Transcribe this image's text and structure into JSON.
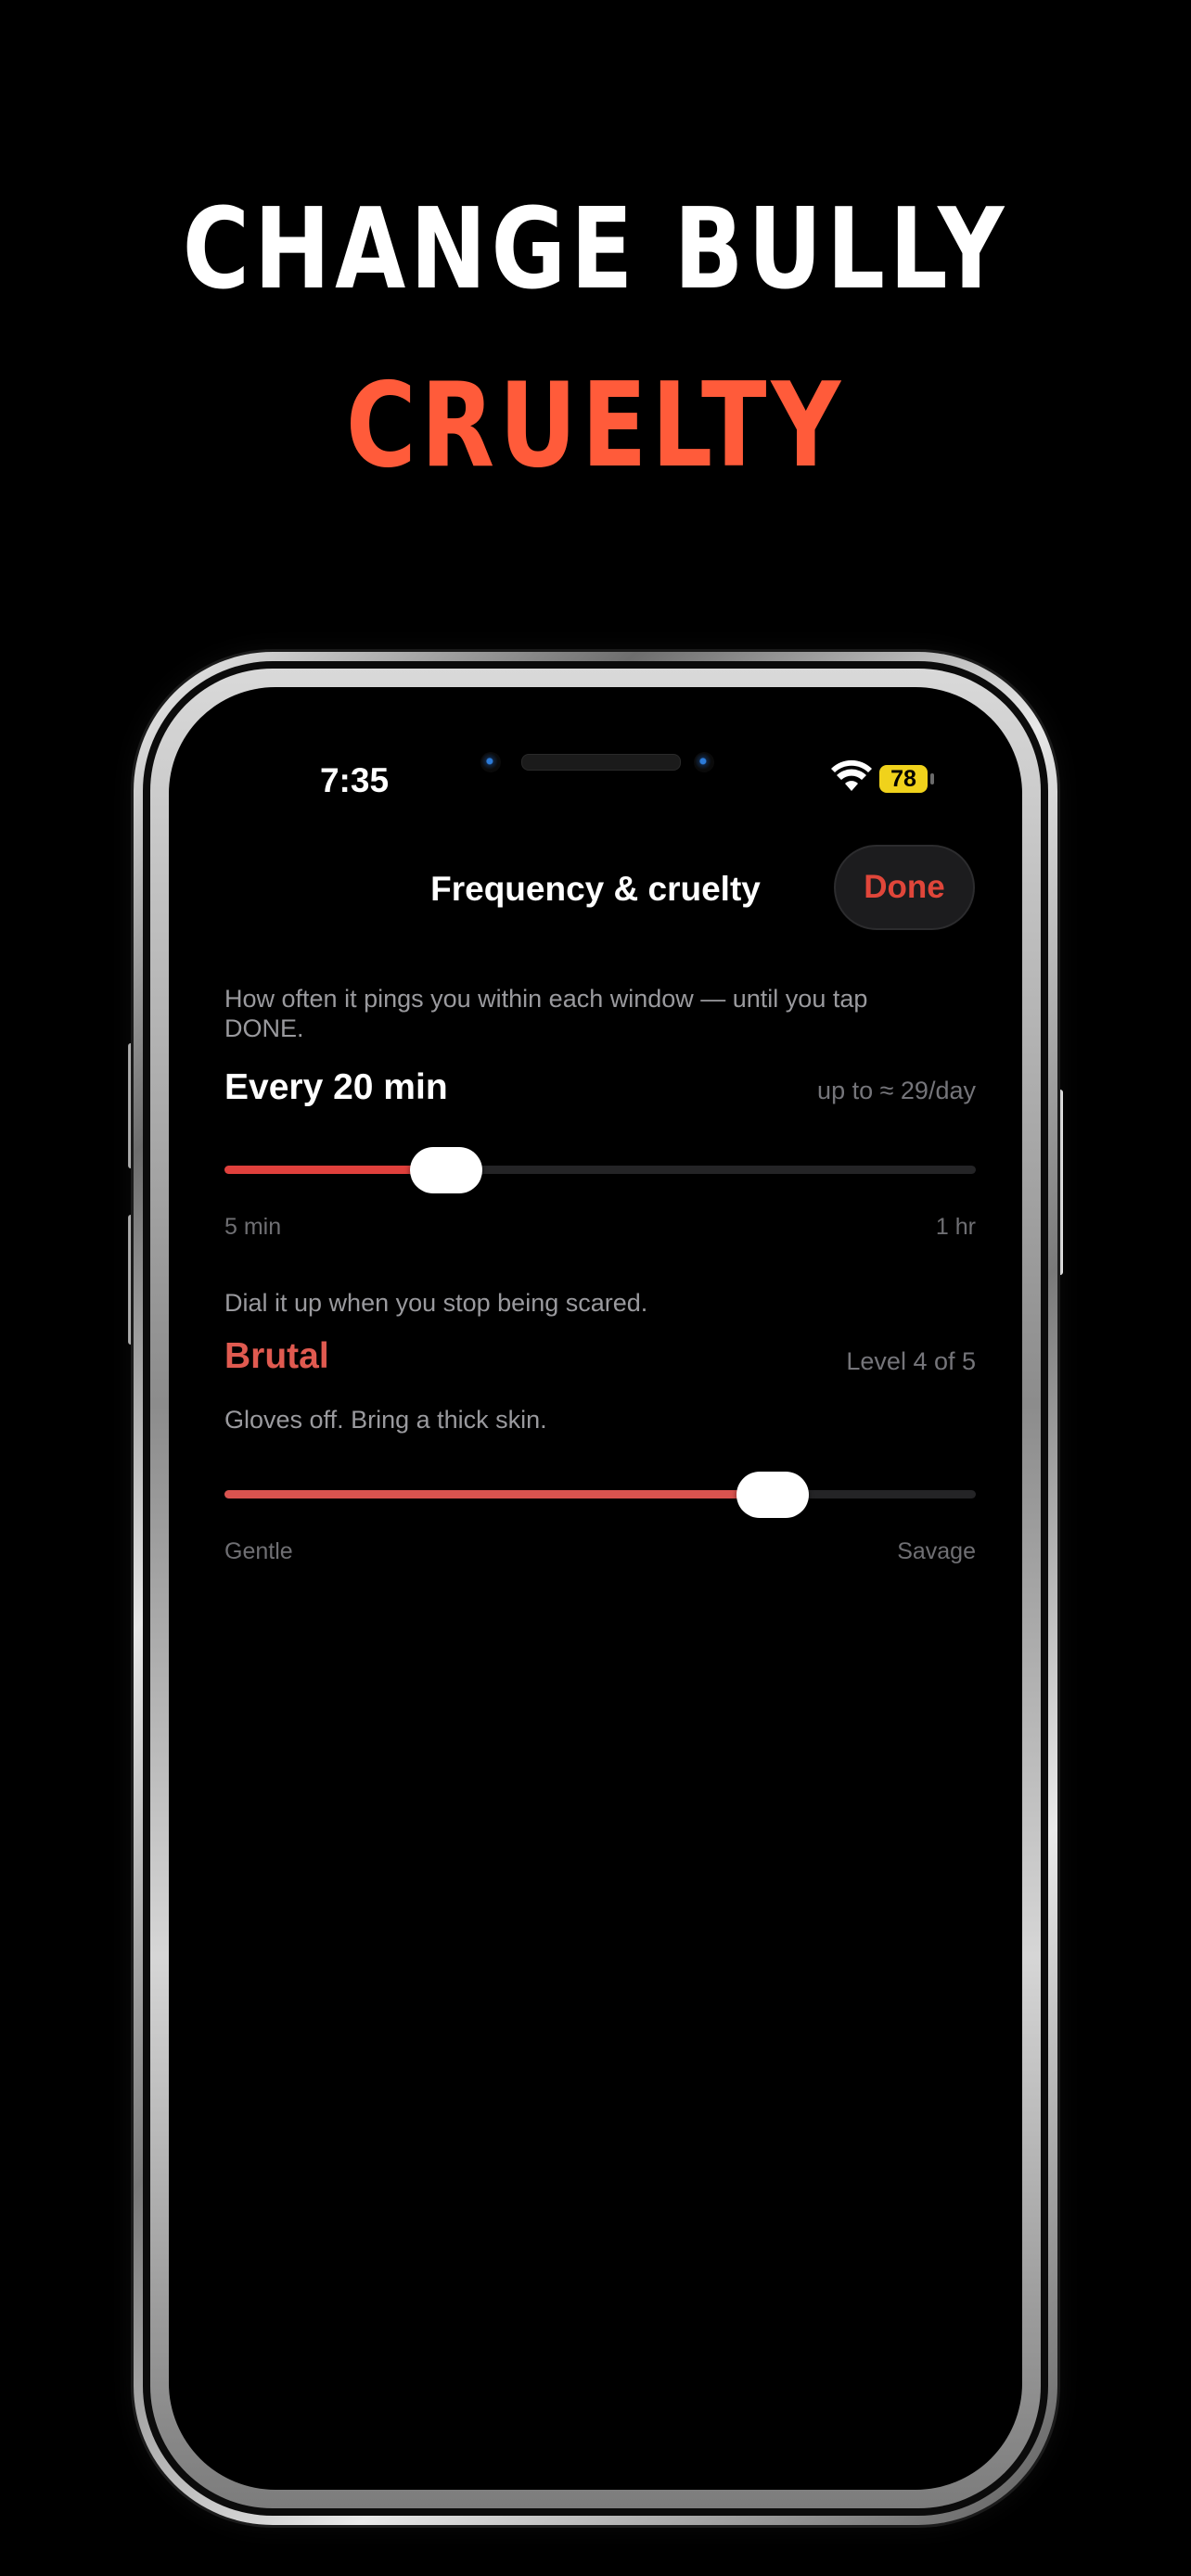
{
  "headline": {
    "line1": "CHANGE BULLY",
    "line2": "CRUELTY"
  },
  "status_bar": {
    "time": "7:35",
    "battery": "78",
    "wifi_icon": "wifi-icon"
  },
  "nav": {
    "title": "Frequency & cruelty",
    "done_label": "Done"
  },
  "frequency": {
    "description": "How often it pings you within each window — until you tap DONE.",
    "value_label": "Every 20 min",
    "note": "up to ≈ 29/day",
    "min_label": "5 min",
    "max_label": "1 hr",
    "position": 0.295
  },
  "cruelty": {
    "description": "Dial it up when you stop being scared.",
    "level_label": "Brutal",
    "level_note": "Level 4 of 5",
    "subtitle": "Gloves off. Bring a thick skin.",
    "min_label": "Gentle",
    "max_label": "Savage",
    "position": 0.73
  },
  "colors": {
    "accent": "#ff5b3a",
    "frequency_fill": "#e0403c",
    "cruelty_fill": "#d9534f",
    "level_text": "#e05a50",
    "battery": "#f0d21b"
  }
}
